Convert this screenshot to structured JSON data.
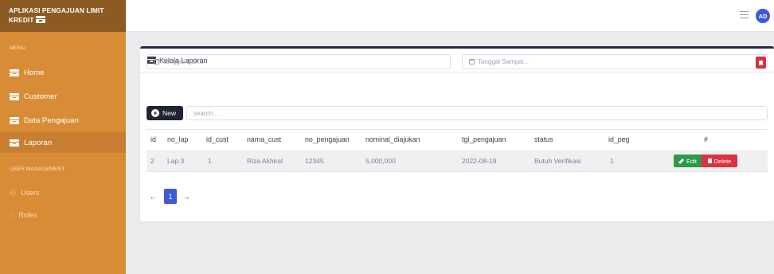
{
  "brand": {
    "line1": "APLIKASI PENGAJUAN LIMIT",
    "line2": "KREDIT"
  },
  "sidebar": {
    "menu_heading": "MENU",
    "items": [
      {
        "label": "Home",
        "icon": "box-icon"
      },
      {
        "label": "Customer",
        "icon": "box-icon"
      },
      {
        "label": "Data Pengajuan",
        "icon": "box-icon"
      },
      {
        "label": "Laporan",
        "icon": "box-icon",
        "active": true
      }
    ],
    "user_heading": "USER MANAGEMENT",
    "user_items": [
      {
        "label": "Users",
        "icon": "users-icon"
      },
      {
        "label": "Roles",
        "icon": "shield-icon"
      }
    ]
  },
  "topbar": {
    "avatar_initials": "AD"
  },
  "card": {
    "title": "Kelola Laporan",
    "date_from_placeholder": "Tanggal Dari...",
    "date_to_placeholder": "Tanggal Sampai...",
    "new_label": "New",
    "search_placeholder": "search..."
  },
  "table": {
    "headers": [
      "id",
      "no_lap",
      "id_cust",
      "nama_cust",
      "no_pengajuan",
      "nominal_diajukan",
      "tgl_pengajuan",
      "status",
      "id_peg",
      "#"
    ],
    "rows": [
      [
        "2",
        "Lap 3",
        "1",
        "Riza Akhirat",
        "12345",
        "5,000,000",
        "2022-08-19",
        "Butuh Verifikasi",
        "1"
      ]
    ],
    "edit_label": "Edit",
    "delete_label": "Delete"
  },
  "pagination": {
    "prev": "←",
    "current": "1",
    "next": "→"
  },
  "colors": {
    "sidebar": "#d98c36",
    "brand": "#8e5a23",
    "primary": "#3d5bd9",
    "edit": "#2b9b47",
    "delete": "#dc3140"
  }
}
